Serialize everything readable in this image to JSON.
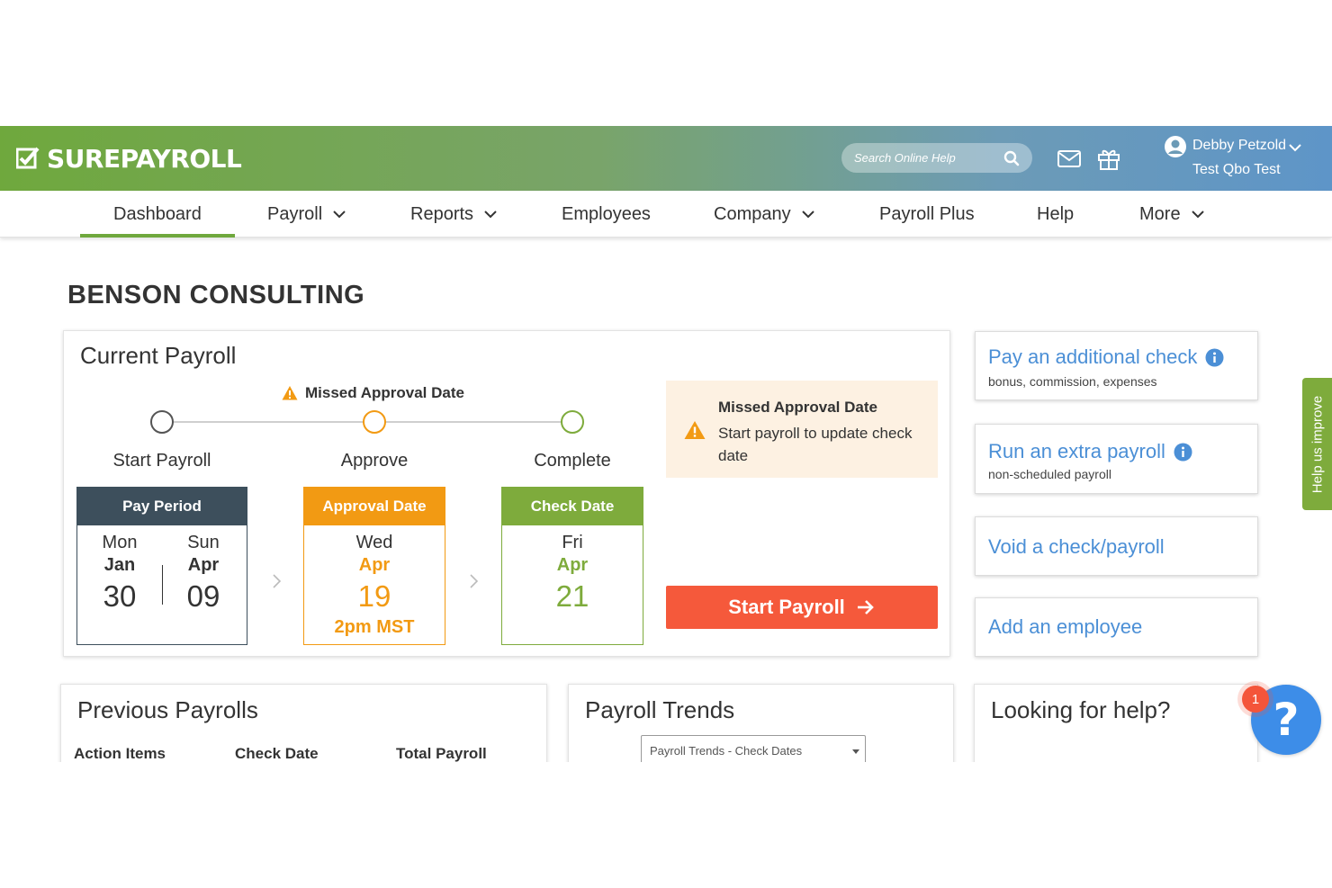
{
  "header": {
    "logo_text": "SUREPAYROLL",
    "search_placeholder": "Search Online Help",
    "user_name": "Debby Petzold",
    "company_account": "Test Qbo Test"
  },
  "nav": {
    "items": [
      {
        "label": "Dashboard",
        "active": true,
        "dropdown": false
      },
      {
        "label": "Payroll",
        "dropdown": true
      },
      {
        "label": "Reports",
        "dropdown": true
      },
      {
        "label": "Employees",
        "dropdown": false
      },
      {
        "label": "Company",
        "dropdown": true
      },
      {
        "label": "Payroll Plus",
        "dropdown": false
      },
      {
        "label": "Help",
        "dropdown": false
      },
      {
        "label": "More",
        "dropdown": true
      }
    ]
  },
  "company_name": "BENSON CONSULTING",
  "current_payroll": {
    "title": "Current Payroll",
    "warning": "Missed Approval Date",
    "steps": [
      "Start Payroll",
      "Approve",
      "Complete"
    ],
    "pay_period": {
      "header": "Pay Period",
      "start": {
        "dow": "Mon",
        "month": "Jan",
        "day": "30"
      },
      "end": {
        "dow": "Sun",
        "month": "Apr",
        "day": "09"
      }
    },
    "approval_date": {
      "header": "Approval Date",
      "dow": "Wed",
      "month": "Apr",
      "day": "19",
      "time": "2pm MST"
    },
    "check_date": {
      "header": "Check Date",
      "dow": "Fri",
      "month": "Apr",
      "day": "21"
    },
    "alert": {
      "title": "Missed Approval Date",
      "text": "Start payroll to update check date"
    },
    "start_button": "Start Payroll"
  },
  "quick_links": [
    {
      "title": "Pay an additional check",
      "subtitle": "bonus, commission, expenses",
      "info": true
    },
    {
      "title": "Run an extra payroll",
      "subtitle": "non-scheduled payroll",
      "info": true
    },
    {
      "title": "Void a check/payroll",
      "subtitle": "",
      "info": false
    },
    {
      "title": "Add an employee",
      "subtitle": "",
      "info": false
    }
  ],
  "previous_payrolls": {
    "title": "Previous Payrolls",
    "columns": [
      "Action Items",
      "Check Date",
      "Total Payroll"
    ]
  },
  "payroll_trends": {
    "title": "Payroll Trends",
    "select_value": "Payroll Trends - Check Dates"
  },
  "help_card": {
    "title": "Looking for help?"
  },
  "feedback_tab": "Help us improve",
  "help_bubble": {
    "glyph": "?",
    "badge": "1"
  },
  "colors": {
    "brand_green": "#6fa83d",
    "brand_blue": "#5e95c8",
    "dark_slate": "#3d4f5c",
    "approval_orange": "#f29a13",
    "check_green": "#7eab3c",
    "start_button": "#f5593b",
    "link_blue": "#4b8fd6",
    "alert_bg": "#fdf1e2"
  }
}
